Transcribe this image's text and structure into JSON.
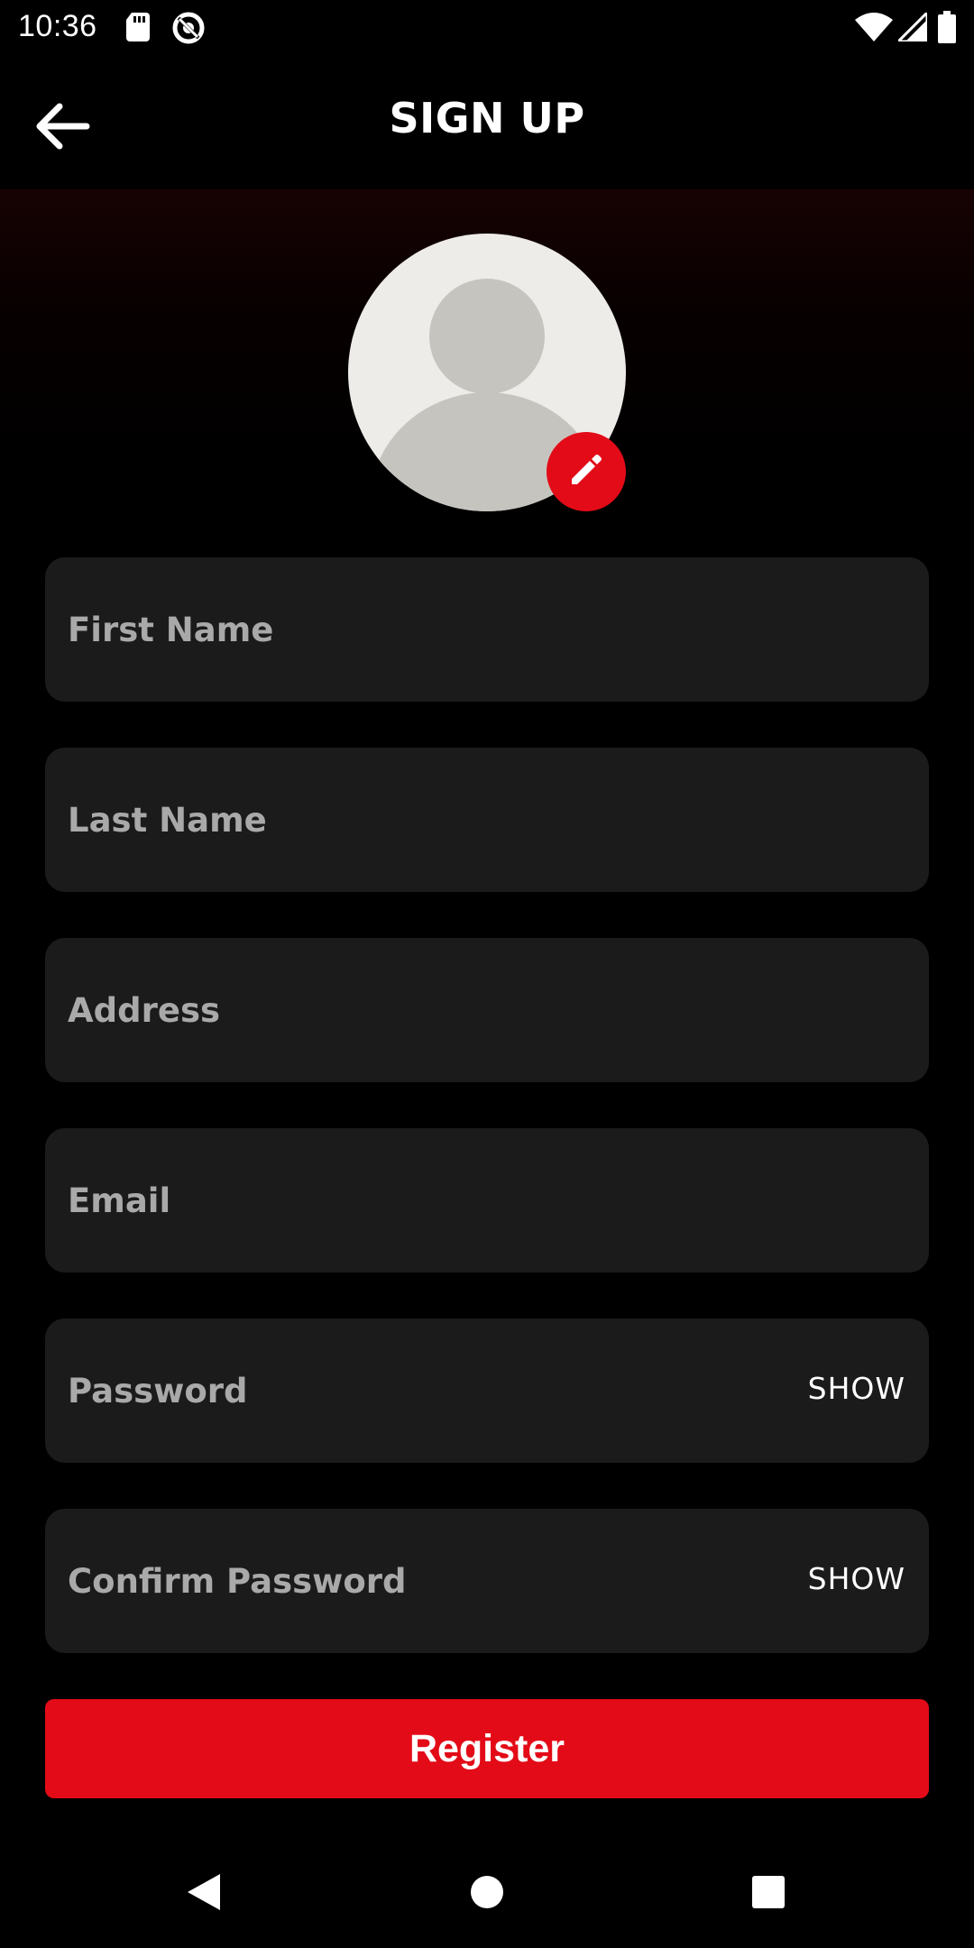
{
  "status_bar": {
    "time": "10:36",
    "left_icons": [
      "sd-card-icon",
      "data-saver-icon"
    ],
    "right_icons": [
      "wifi-icon",
      "cellular-signal-icon",
      "battery-icon"
    ]
  },
  "header": {
    "title": "SIGN UP",
    "back_icon": "arrow-left-icon"
  },
  "profile": {
    "avatar_icon": "default-avatar-icon",
    "edit_icon": "pencil-icon"
  },
  "form": {
    "first_name": {
      "placeholder": "First Name",
      "value": ""
    },
    "last_name": {
      "placeholder": "Last Name",
      "value": ""
    },
    "address": {
      "placeholder": "Address",
      "value": ""
    },
    "email": {
      "placeholder": "Email",
      "value": ""
    },
    "password": {
      "placeholder": "Password",
      "value": "",
      "toggle_label": "SHOW"
    },
    "confirm_password": {
      "placeholder": "Confirm Password",
      "value": "",
      "toggle_label": "SHOW"
    },
    "register_label": "Register"
  },
  "nav_bar": {
    "icons": [
      "back-triangle-icon",
      "home-circle-icon",
      "recents-square-icon"
    ]
  },
  "colors": {
    "accent": "#e30b17",
    "background": "#000000",
    "field_background": "#1b1b1b",
    "placeholder": "#a9a9a9",
    "avatar_background": "#eeece8",
    "avatar_silhouette": "#c6c4bf"
  }
}
